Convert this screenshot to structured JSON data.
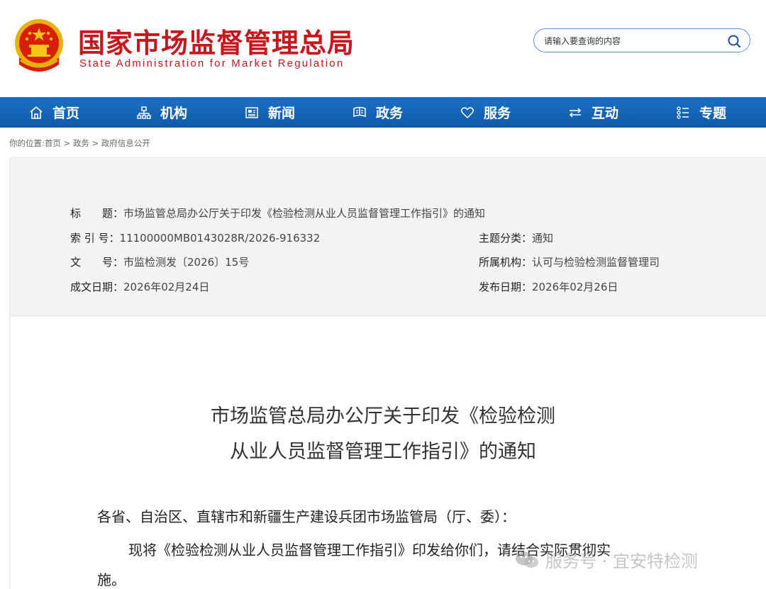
{
  "header": {
    "title_cn": "国家市场监督管理总局",
    "title_en": "State Administration for Market Regulation",
    "emblem_icon": "national-emblem-icon",
    "brand_color": "#c8161d"
  },
  "search": {
    "placeholder": "请输入要查询的内容",
    "icon": "search-icon",
    "border_color": "#5b8fd6"
  },
  "nav": {
    "color": "#1565b8",
    "items": [
      {
        "label": "首页",
        "icon": "home-icon"
      },
      {
        "label": "机构",
        "icon": "org-chart-icon"
      },
      {
        "label": "新闻",
        "icon": "newspaper-icon"
      },
      {
        "label": "政务",
        "icon": "government-icon"
      },
      {
        "label": "服务",
        "icon": "heart-icon"
      },
      {
        "label": "互动",
        "icon": "exchange-icon"
      },
      {
        "label": "专题",
        "icon": "topics-icon"
      }
    ]
  },
  "breadcrumb": {
    "prefix": "你的位置:",
    "items": [
      "首页",
      "政务",
      "政府信息公开"
    ],
    "separator": " > "
  },
  "meta": {
    "title_label": "标　　题：",
    "title_value": "市场监管总局办公厅关于印发《检验检测从业人员监督管理工作指引》的通知",
    "index_label": "索 引 号：",
    "index_value": "11100000MB0143028R/2026-916332",
    "category_label": "主题分类：",
    "category_value": "通知",
    "docno_label": "文　　号：",
    "docno_value": "市监检测发〔2026〕15号",
    "dept_label": "所属机构：",
    "dept_value": "认可与检验检测监督管理司",
    "written_label": "成文日期：",
    "written_value": "2026年02月24日",
    "published_label": "发布日期：",
    "published_value": "2026年02月26日"
  },
  "article": {
    "title_line1": "市场监管总局办公厅关于印发《检验检测",
    "title_line2": "从业人员监督管理工作指引》的通知",
    "salutation": "各省、自治区、直辖市和新疆生产建设兵团市场监管局（厅、委）：",
    "body_line1": "现将《检验检测从业人员监督管理工作指引》印发给你们，请结合实际贯彻实",
    "body_line2": "施。"
  },
  "watermark": {
    "text": "服务号 · 宜安特检测",
    "icon": "wechat-icon"
  }
}
